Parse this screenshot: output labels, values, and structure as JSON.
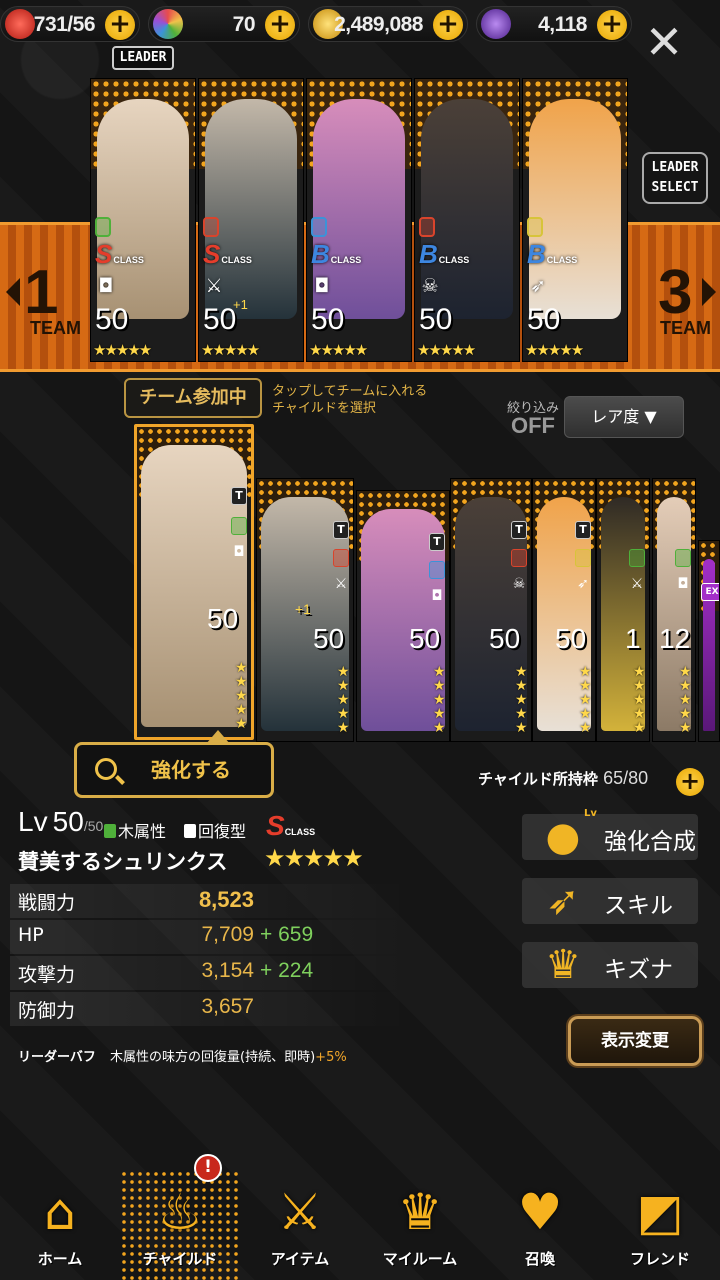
{
  "currencies": [
    {
      "name": "stamina",
      "icon": "heart-icon",
      "value": "731/56",
      "color": "#e2322b"
    },
    {
      "name": "gems",
      "icon": "rainbow-gem-icon",
      "value": "70",
      "color": "#6ab2e8"
    },
    {
      "name": "gold",
      "icon": "coin-icon",
      "value": "2,489,088",
      "color": "#f0c24a"
    },
    {
      "name": "crystal",
      "icon": "purple-gem-icon",
      "value": "4,118",
      "color": "#7a3cc8"
    }
  ],
  "close_glyph": "✕",
  "leader_tag": "LEADER",
  "leader_select": [
    "LEADER",
    "SELECT"
  ],
  "team_nav": {
    "prev": {
      "num": "1",
      "label": "TEAM"
    },
    "next": {
      "num": "3",
      "label": "TEAM"
    }
  },
  "team": [
    {
      "cls": "S",
      "cls_color": "#e53d2b",
      "elem": "#4fb03a",
      "type": "◘",
      "lv": "50",
      "stars": "★★★★★",
      "plus": "",
      "tones": [
        "#e7d5c0",
        "#a79173"
      ]
    },
    {
      "cls": "S",
      "cls_color": "#e53d2b",
      "elem": "#d9442c",
      "type": "⚔",
      "lv": "50",
      "stars": "★★★★★",
      "plus": "+1",
      "tones": [
        "#c3b8a9",
        "#24323a"
      ]
    },
    {
      "cls": "B",
      "cls_color": "#3d86e0",
      "elem": "#3b93d8",
      "type": "◘",
      "lv": "50",
      "stars": "★★★★★",
      "plus": "",
      "tones": [
        "#d78dbb",
        "#6f4f9a"
      ]
    },
    {
      "cls": "B",
      "cls_color": "#3d86e0",
      "elem": "#d9442c",
      "type": "☠",
      "lv": "50",
      "stars": "★★★★★",
      "plus": "",
      "tones": [
        "#4b4038",
        "#1d2330"
      ]
    },
    {
      "cls": "B",
      "cls_color": "#3d86e0",
      "elem": "#d7c43a",
      "type": "➶",
      "lv": "50",
      "stars": "★★★★★",
      "plus": "",
      "tones": [
        "#f0a34a",
        "#e8e0d6"
      ]
    }
  ],
  "controls": {
    "in_team_label": "チーム参加中",
    "hint_line1": "タップしてチームに入れる",
    "hint_line2": "チャイルドを選択",
    "filter_label": "絞り込み",
    "filter_value": "OFF",
    "sort_label": "レア度 ▼"
  },
  "roster": [
    {
      "lv": "50",
      "badge": "T",
      "elem": "#4fb03a",
      "type": "◘",
      "tones": [
        "#e7d5c0",
        "#a79173"
      ],
      "stars": 5,
      "plus": ""
    },
    {
      "lv": "50",
      "badge": "T",
      "elem": "#d9442c",
      "type": "⚔",
      "tones": [
        "#c3b8a9",
        "#24323a"
      ],
      "stars": 5,
      "plus": "+1"
    },
    {
      "lv": "50",
      "badge": "T",
      "elem": "#3b93d8",
      "type": "◘",
      "tones": [
        "#d78dbb",
        "#6f4f9a"
      ],
      "stars": 5,
      "plus": ""
    },
    {
      "lv": "50",
      "badge": "T",
      "elem": "#d9442c",
      "type": "☠",
      "tones": [
        "#4b4038",
        "#1d2330"
      ],
      "stars": 5,
      "plus": ""
    },
    {
      "lv": "50",
      "badge": "T",
      "elem": "#d7c43a",
      "type": "➶",
      "tones": [
        "#f0a34a",
        "#e8e0d6"
      ],
      "stars": 5,
      "plus": ""
    },
    {
      "lv": "1",
      "badge": "",
      "elem": "#4fb03a",
      "type": "⚔",
      "tones": [
        "#2f2a25",
        "#d3b23a"
      ],
      "stars": 5,
      "plus": ""
    },
    {
      "lv": "12",
      "badge": "",
      "elem": "#4fb03a",
      "type": "◘",
      "tones": [
        "#e4cdb8",
        "#8c7a66"
      ],
      "stars": 5,
      "plus": ""
    },
    {
      "lv": "",
      "badge": "EX",
      "elem": "#b43ad6",
      "type": "",
      "tones": [
        "#a32fc8",
        "#5a1878"
      ],
      "stars": 0,
      "plus": ""
    }
  ],
  "enhance_label": "強化する",
  "capacity": {
    "label": "チャイルド所持枠",
    "value": "65/80"
  },
  "detail": {
    "lv_prefix": "Lv",
    "lv": "50",
    "lv_max": "/50",
    "attribute": "木属性",
    "attribute_color": "#4fb03a",
    "role": "回復型",
    "cls": "S",
    "cls_suffix": "CLASS",
    "name": "賛美するシュリンクス",
    "stars": "★★★★★"
  },
  "stats": [
    {
      "label": "戦闘力",
      "value": "8,523",
      "bonus": ""
    },
    {
      "label": "HP",
      "value": "7,709",
      "bonus": "+ 659"
    },
    {
      "label": "攻撃力",
      "value": "3,154",
      "bonus": "+ 224"
    },
    {
      "label": "防御力",
      "value": "3,657",
      "bonus": ""
    }
  ],
  "leader_buff": {
    "label": "リーダーバフ",
    "text": "木属性の味方の回復量(持続、即時)",
    "pct": "+5%"
  },
  "side_buttons": [
    {
      "label": "強化合成",
      "icon": "enhance-fusion-icon",
      "tag": "Lv"
    },
    {
      "label": "スキル",
      "icon": "skill-icon",
      "tag": ""
    },
    {
      "label": "キズナ",
      "icon": "bond-icon",
      "tag": ""
    }
  ],
  "view_change_label": "表示変更",
  "nav": [
    {
      "label": "ホーム",
      "icon": "home-icon",
      "glyph": "⌂",
      "active": false
    },
    {
      "label": "チャイルド",
      "icon": "child-flame-icon",
      "glyph": "♨",
      "active": true
    },
    {
      "label": "アイテム",
      "icon": "sword-shield-icon",
      "glyph": "⚔",
      "active": false
    },
    {
      "label": "マイルーム",
      "icon": "crown-laurel-icon",
      "glyph": "♛",
      "active": false
    },
    {
      "label": "召喚",
      "icon": "summon-bottle-icon",
      "glyph": "♥",
      "active": false
    },
    {
      "label": "フレンド",
      "icon": "friend-shield-icon",
      "glyph": "◩",
      "active": false
    }
  ],
  "alert_glyph": "!"
}
